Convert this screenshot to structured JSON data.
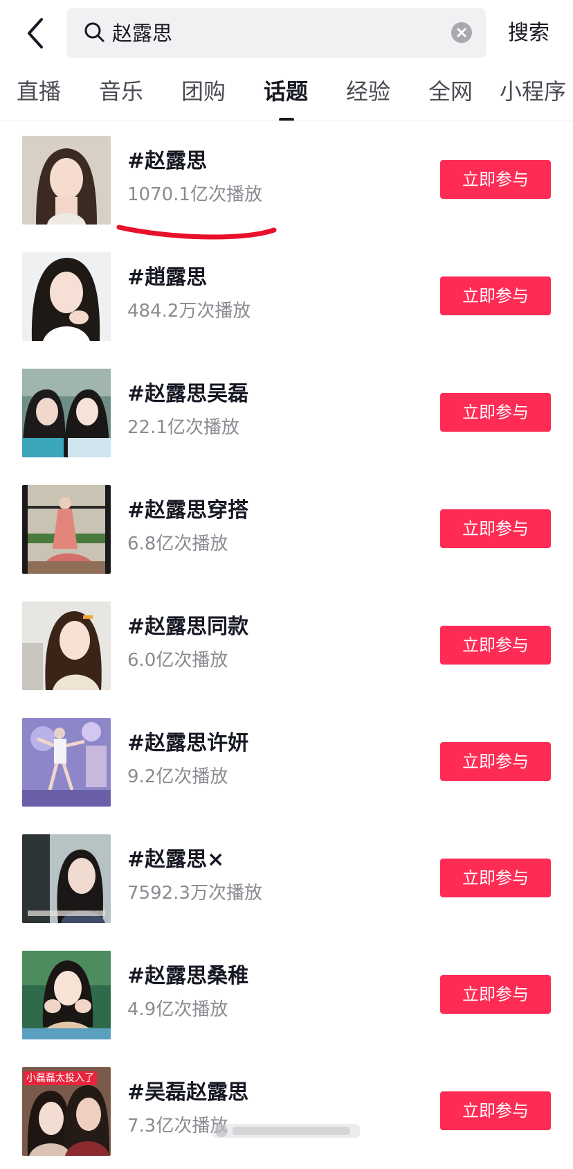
{
  "header": {
    "search_query": "赵露思",
    "search_button": "搜索"
  },
  "tabs": [
    {
      "label": "直播"
    },
    {
      "label": "音乐"
    },
    {
      "label": "团购"
    },
    {
      "label": "话题",
      "active": true
    },
    {
      "label": "经验"
    },
    {
      "label": "全网"
    },
    {
      "label": "小程序"
    }
  ],
  "topics": [
    {
      "title": "#赵露思",
      "views": "1070.1亿次播放",
      "button": "立即参与"
    },
    {
      "title": "#趙露思",
      "views": "484.2万次播放",
      "button": "立即参与"
    },
    {
      "title": "#赵露思吴磊",
      "views": "22.1亿次播放",
      "button": "立即参与"
    },
    {
      "title": "#赵露思穿搭",
      "views": "6.8亿次播放",
      "button": "立即参与"
    },
    {
      "title": "#赵露思同款",
      "views": "6.0亿次播放",
      "button": "立即参与"
    },
    {
      "title": "#赵露思许妍",
      "views": "9.2亿次播放",
      "button": "立即参与"
    },
    {
      "title": "#赵露思×",
      "views": "7592.3万次播放",
      "button": "立即参与"
    },
    {
      "title": "#赵露思桑稚",
      "views": "4.9亿次播放",
      "button": "立即参与"
    },
    {
      "title": "#吴磊赵露思",
      "views": "7.3亿次播放",
      "button": "立即参与",
      "thumb_overlay": "小磊磊太投入了"
    }
  ],
  "colors": {
    "accent": "#fe2c55",
    "annotation": "#e8102a",
    "text_primary": "#161823",
    "text_secondary": "#8a8b91"
  },
  "icons": {
    "back": "chevron-left-icon",
    "search": "search-icon",
    "clear": "clear-icon"
  }
}
